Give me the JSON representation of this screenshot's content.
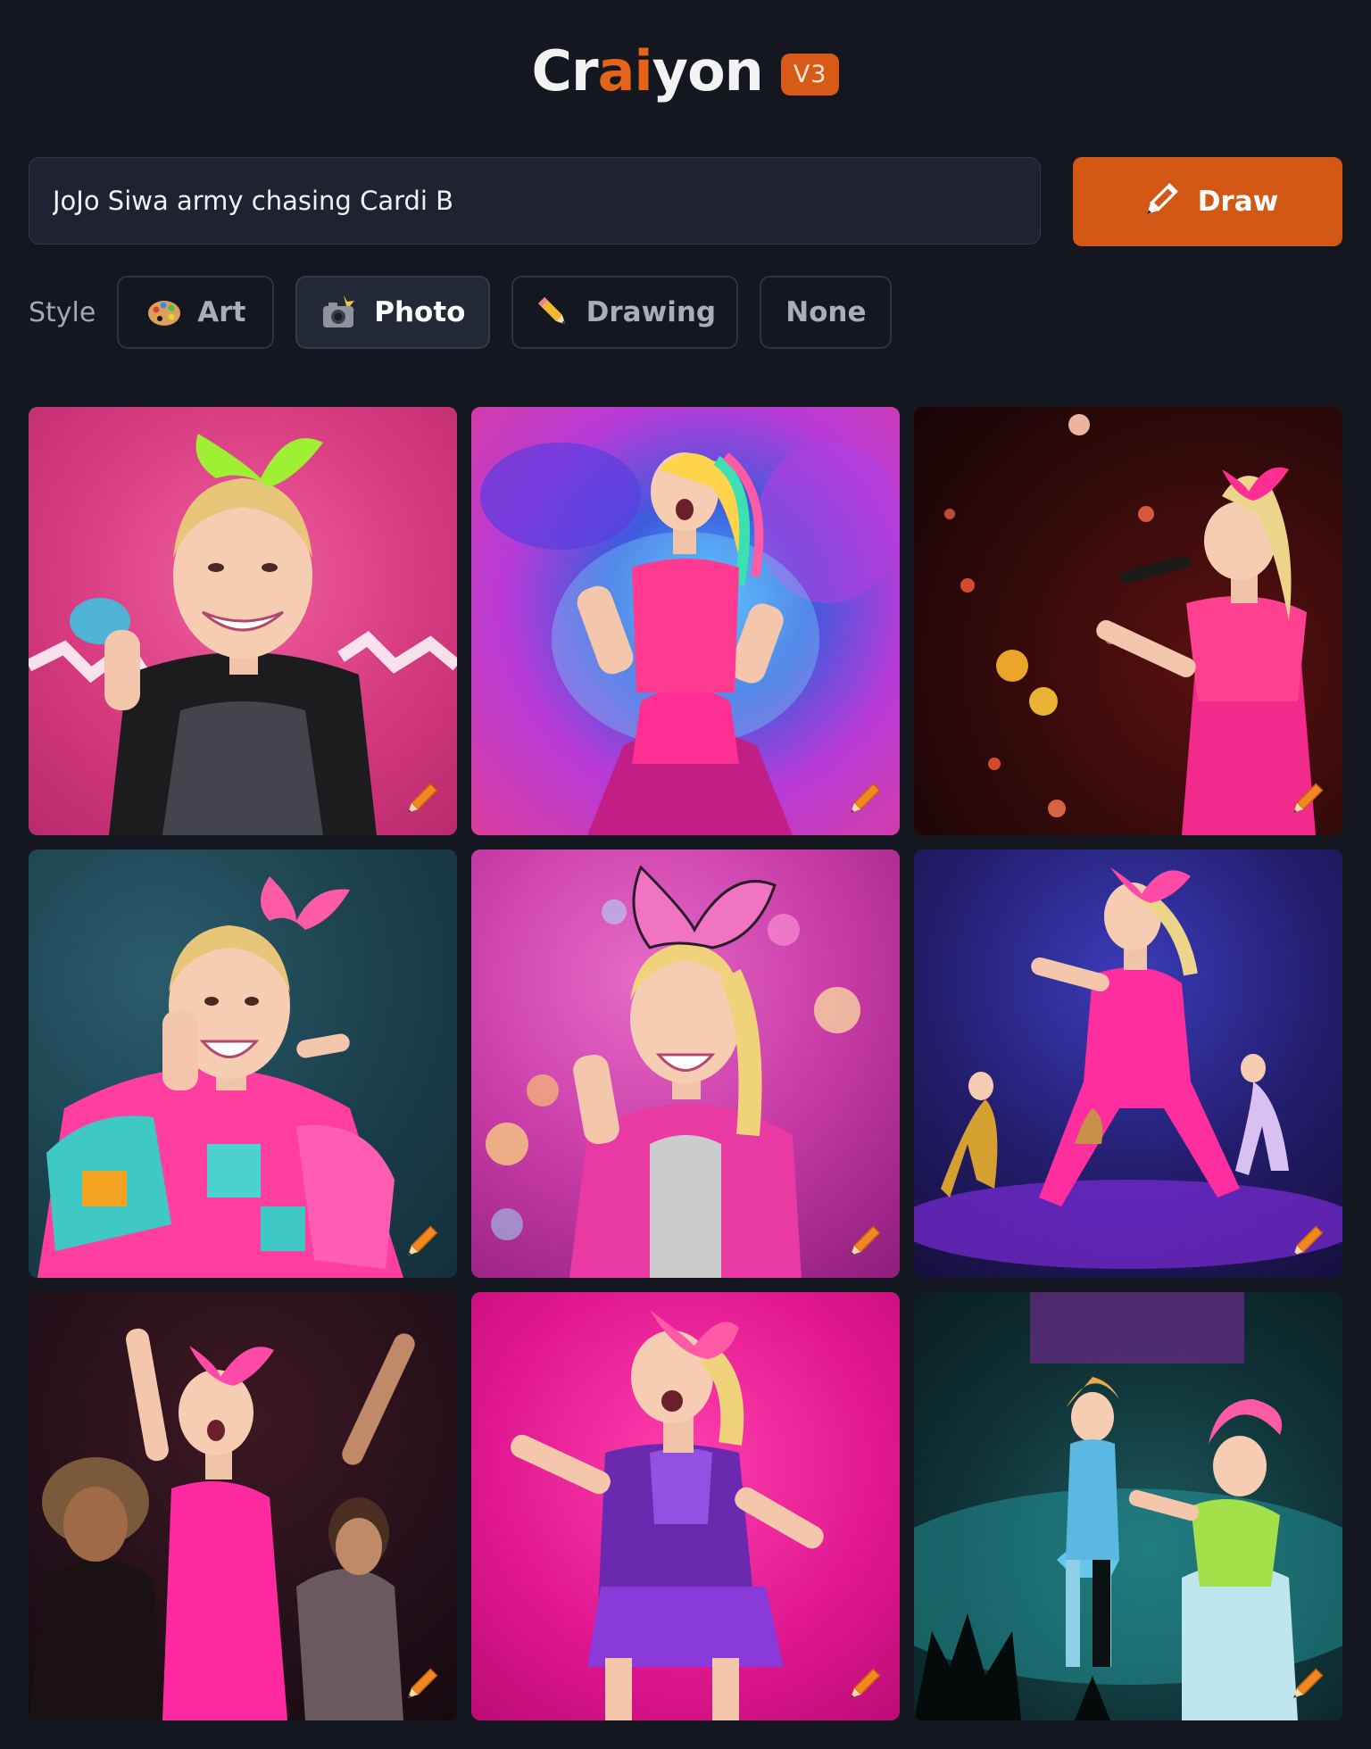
{
  "header": {
    "logo_text_part1": "Cr",
    "logo_text_accent": "ai",
    "logo_text_part2": "yon",
    "version_badge": "V3"
  },
  "search": {
    "prompt_value": "JoJo Siwa army chasing Cardi B",
    "draw_label": "Draw",
    "draw_icon": "pencil-icon"
  },
  "styles": {
    "label": "Style",
    "options": [
      {
        "label": "Art",
        "icon": "palette-icon",
        "selected": false
      },
      {
        "label": "Photo",
        "icon": "camera-flash-icon",
        "selected": true
      },
      {
        "label": "Drawing",
        "icon": "pencil-icon",
        "selected": false
      },
      {
        "label": "None",
        "icon": "",
        "selected": false
      }
    ]
  },
  "results": {
    "count": 9,
    "tile_edit_icon": "pencil-icon"
  },
  "colors": {
    "background": "#141720",
    "accent": "#d35815",
    "input_background": "#1f2331"
  }
}
